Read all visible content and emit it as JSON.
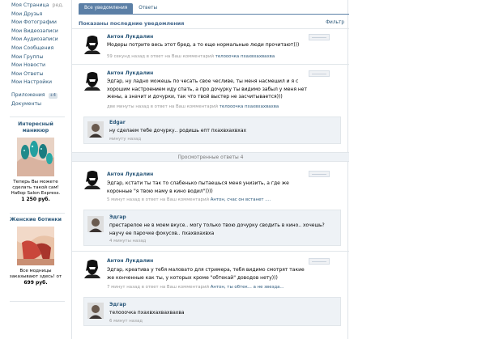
{
  "sidebar": {
    "items": [
      {
        "label": "Моя Страница",
        "edit": "ред."
      },
      {
        "label": "Мои Друзья"
      },
      {
        "label": "Мои Фотографии"
      },
      {
        "label": "Мои Видеозаписи"
      },
      {
        "label": "Мои Аудиозаписи"
      },
      {
        "label": "Мои Сообщения"
      },
      {
        "label": "Мои Группы"
      },
      {
        "label": "Мои Новости"
      },
      {
        "label": "Мои Ответы"
      },
      {
        "label": "Мои Настройки"
      }
    ],
    "extra": [
      {
        "label": "Приложения",
        "badge": "+4"
      },
      {
        "label": "Документы"
      }
    ]
  },
  "ads": [
    {
      "title": "Интересный маникюр",
      "text": "Теперь Вы можете сделать такой сам! Набор Salon Express.",
      "price": "1 250 руб."
    },
    {
      "title": "Женские ботинки",
      "text": "Все модницы заказывают здесь! от",
      "price": "699 руб."
    }
  ],
  "tabs": {
    "active": "Все уведомления",
    "inactive": "Ответы"
  },
  "summary": {
    "title": "Показаны последние уведомления",
    "filter": "Фильтр"
  },
  "viewed_label": "Просмотренные ответы  4",
  "notifications": [
    {
      "name": "Антон Лукдалин",
      "text": "Модеры потрите весь этот бред, а то еще нормальные люди прочитают)))",
      "meta": "59 секунд назад в ответ на Ваш комментарий ",
      "meta_link": "телооочка пхахвхахвахва"
    },
    {
      "name": "Антон Лукдалин",
      "text": "Эдгар, ну ладно можешь по чесать свое чесливе, ты меня насмешил и я с хорошим настроением иду спать, а про дочурку ты видимо забыл у меня нет жены, а значит и дочурки, так что твой выстер не засчитывается)))",
      "meta": "две минуты назад в ответ на Ваш комментарий ",
      "meta_link": "телооочка пхахвхахвахва",
      "reply": {
        "name": "Edgar",
        "text": "ну сделаем тебе дочурку.. родишь епт пхахвхахвхах",
        "meta": "минуту назад"
      }
    },
    {
      "name": "Антон Лукдалин",
      "text": "Эдгар, кстати ты так то слабенько пытаешься меня унизить, а где же коронные \"я твою маму в кино водил\"))))",
      "meta": "5 минут назад в ответ на Ваш комментарий ",
      "meta_link": "Антон, счас он встанет ....",
      "reply": {
        "name": "Эдгар",
        "text": "престарелое не в моем вкусе.. могу только твою дочурку сводить в кино.. хочешь? научу ее парочке фокусов.. пхахвхахвха",
        "meta": "4 минуты назад"
      }
    },
    {
      "name": "Антон Лукдалин",
      "text": "Эдгар, креатива у тебя маловато для стримера, тебя видимо смотрят такие же конченные как ты, у которых кроме \"обтекай\" доводов нету)))",
      "meta": "7 минут назад в ответ на Ваш комментарий ",
      "meta_link": "Антон, ты обтек... а не звезда...",
      "reply": {
        "name": "Эдгар",
        "text": "телооочка пхахвхахвахвахва",
        "meta": "6 минут назад"
      }
    }
  ]
}
